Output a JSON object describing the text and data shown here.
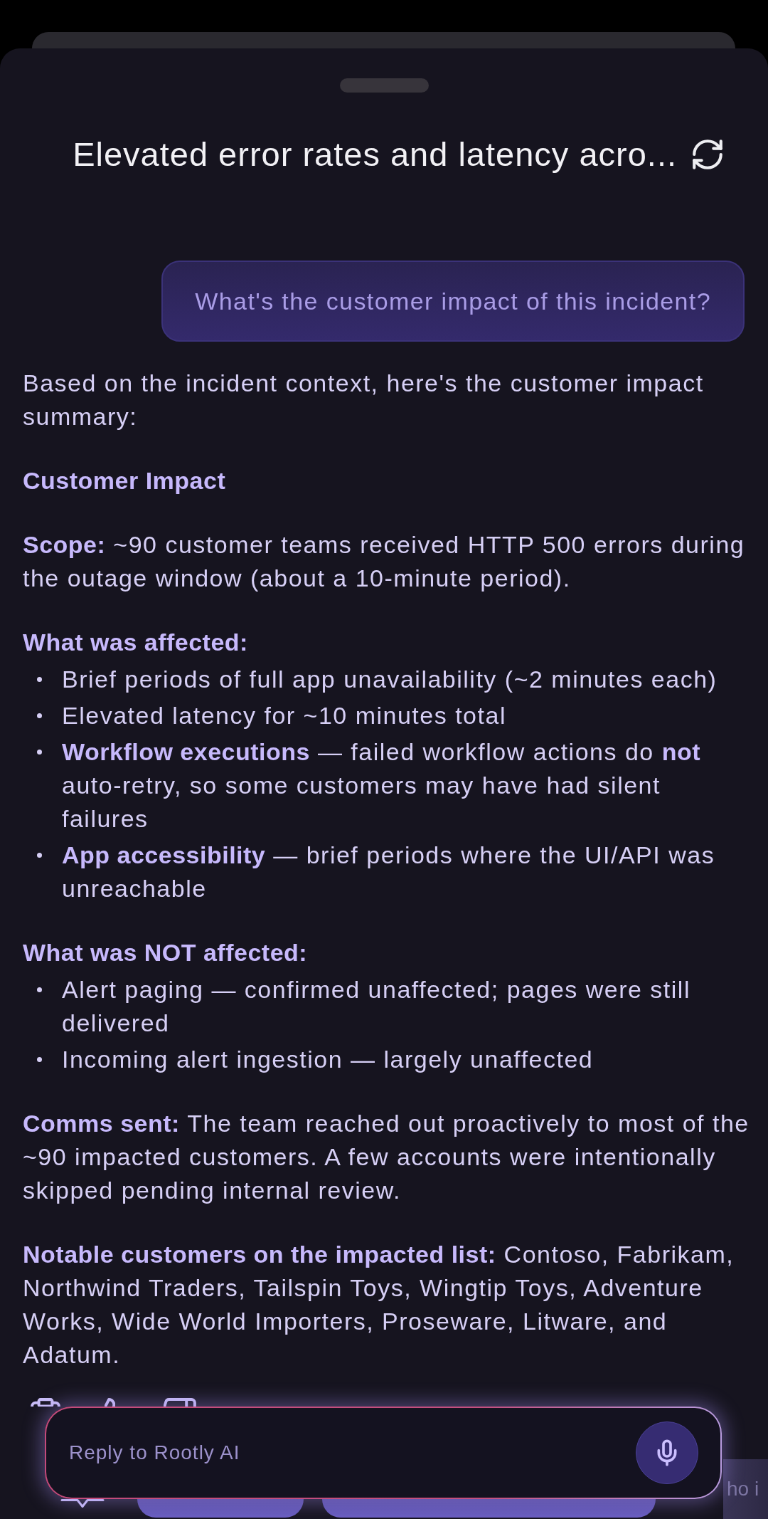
{
  "sheet": {
    "title": "Elevated error rates and latency acro..."
  },
  "conversation": {
    "user_message": "What's the customer impact of this incident?",
    "answer": [
      {
        "kind": "paragraph",
        "text": "Based on the incident context, here's the customer impact summary:"
      },
      {
        "kind": "heading",
        "text": "Customer Impact"
      },
      {
        "kind": "paragraph",
        "text": "**Scope:** ~90 customer teams received HTTP 500 errors during the outage window (about a 10-minute period)."
      },
      {
        "kind": "list",
        "title": "What was affected:",
        "items": [
          "Brief periods of full app unavailability (~2 minutes each)",
          "Elevated latency for ~10 minutes total",
          "**Workflow executions** — failed workflow actions do **not** auto-retry, so some customers may have had silent failures",
          "**App accessibility** — brief periods where the UI/API was unreachable"
        ]
      },
      {
        "kind": "list",
        "title": "What was NOT affected:",
        "items": [
          "Alert paging — confirmed unaffected; pages were still delivered",
          "Incoming alert ingestion — largely unaffected"
        ]
      },
      {
        "kind": "paragraph",
        "text": "**Comms sent:** The team reached out proactively to most of the ~90 impacted customers. A few accounts were intentionally skipped pending internal review."
      },
      {
        "kind": "paragraph",
        "text": "**Notable customers on the impacted list:** Contoso, Fabrikam, Northwind Traders, Tailspin Toys, Wingtip Toys, Adventure Works, Wide World Importers, Proseware, Litware, and Adatum."
      }
    ]
  },
  "composer": {
    "placeholder": "Reply to Rootly AI"
  },
  "suggestions": [
    {
      "kind": "covered"
    },
    {
      "kind": "covered"
    },
    {
      "kind": "text",
      "label": "ho i"
    }
  ]
}
